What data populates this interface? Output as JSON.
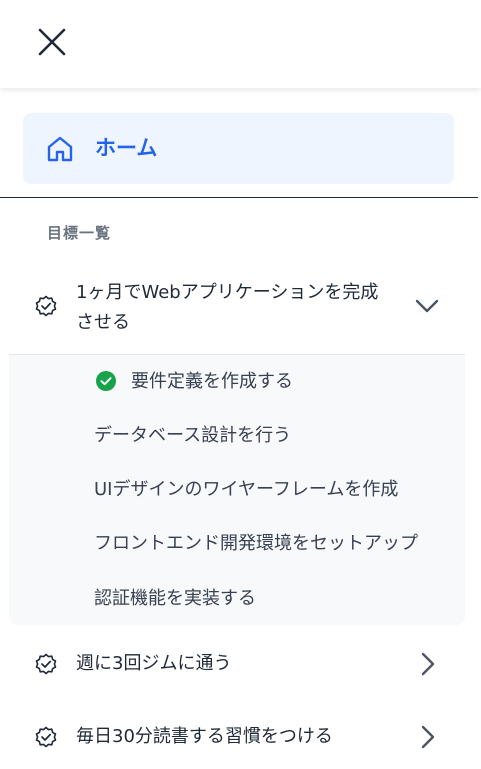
{
  "header": {
    "close_icon": "close-icon"
  },
  "nav": {
    "home_label": "ホーム",
    "home_icon": "home-icon",
    "accent_color": "#2563eb",
    "active_bg": "#eff5ff"
  },
  "goals_section": {
    "title": "目標一覧",
    "goals": [
      {
        "title": "1ヶ月でWebアプリケーションを完成させる",
        "title_line1": "1ヶ月でWebアプリケーションを完成",
        "title_line2": "させる",
        "expanded": true,
        "tasks": [
          {
            "label": "要件定義を作成する",
            "completed": true
          },
          {
            "label": "データベース設計を行う",
            "completed": false
          },
          {
            "label": "UIデザインのワイヤーフレームを作成",
            "completed": false
          },
          {
            "label": "フロントエンド開発環境をセットアップ",
            "completed": false
          },
          {
            "label": "認証機能を実装する",
            "completed": false
          }
        ]
      },
      {
        "title": "週に3回ジムに通う",
        "expanded": false
      },
      {
        "title": "毎日30分読書する習慣をつける",
        "expanded": false
      }
    ]
  },
  "colors": {
    "completed": "#16a34a",
    "text": "#1f2937",
    "muted": "#6b7280"
  }
}
